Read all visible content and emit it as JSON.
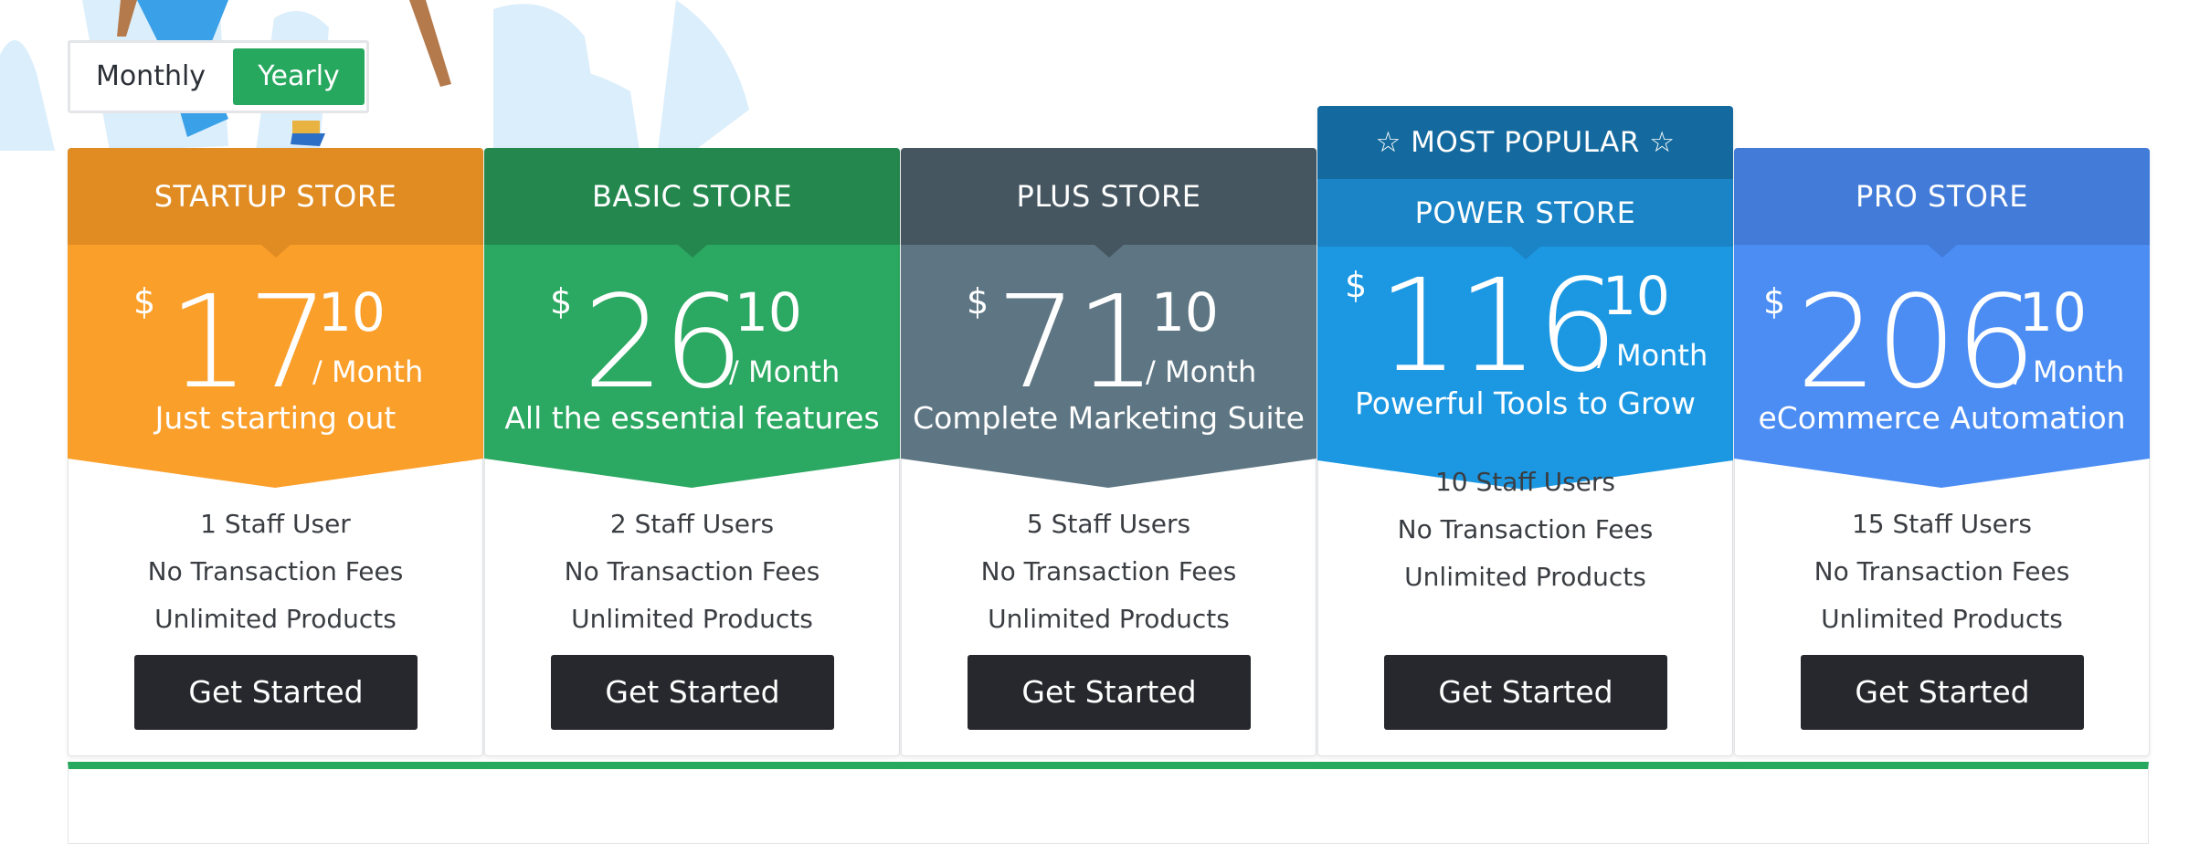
{
  "billing_toggle": {
    "monthly_label": "Monthly",
    "yearly_label": "Yearly",
    "selected": "Yearly"
  },
  "popular_badge": "☆ MOST POPULAR ☆",
  "plans": [
    {
      "name": "STARTUP STORE",
      "currency": "$",
      "price": "17",
      "cents": "10",
      "period": "/ Month",
      "tagline": "Just starting out",
      "features": [
        "1 Staff User",
        "No Transaction Fees",
        "Unlimited Products"
      ],
      "cta": "Get Started",
      "colors": {
        "header": "#e08c22",
        "body": "#fb9f2b"
      }
    },
    {
      "name": "BASIC STORE",
      "currency": "$",
      "price": "26",
      "cents": "10",
      "period": "/ Month",
      "tagline": "All the essential features",
      "features": [
        "2 Staff Users",
        "No Transaction Fees",
        "Unlimited Products"
      ],
      "cta": "Get Started",
      "colors": {
        "header": "#24884e",
        "body": "#2ba861"
      }
    },
    {
      "name": "PLUS STORE",
      "currency": "$",
      "price": "71",
      "cents": "10",
      "period": "/ Month",
      "tagline": "Complete Marketing Suite",
      "features": [
        "5 Staff Users",
        "No Transaction Fees",
        "Unlimited Products"
      ],
      "cta": "Get Started",
      "colors": {
        "header": "#455660",
        "body": "#5e7683"
      }
    },
    {
      "name": "POWER STORE",
      "currency": "$",
      "price": "116",
      "cents": "10",
      "period": "/ Month",
      "tagline": "Powerful Tools to Grow",
      "features": [
        "10 Staff Users",
        "No Transaction Fees",
        "Unlimited Products"
      ],
      "cta": "Get Started",
      "colors": {
        "header": "#1a84c6",
        "body": "#1c98e2"
      }
    },
    {
      "name": "PRO STORE",
      "currency": "$",
      "price": "206",
      "cents": "10",
      "period": "/ Month",
      "tagline": "eCommerce Automation",
      "features": [
        "15 Staff Users",
        "No Transaction Fees",
        "Unlimited Products"
      ],
      "cta": "Get Started",
      "colors": {
        "header": "#427bd8",
        "body": "#4b8df3"
      }
    }
  ]
}
